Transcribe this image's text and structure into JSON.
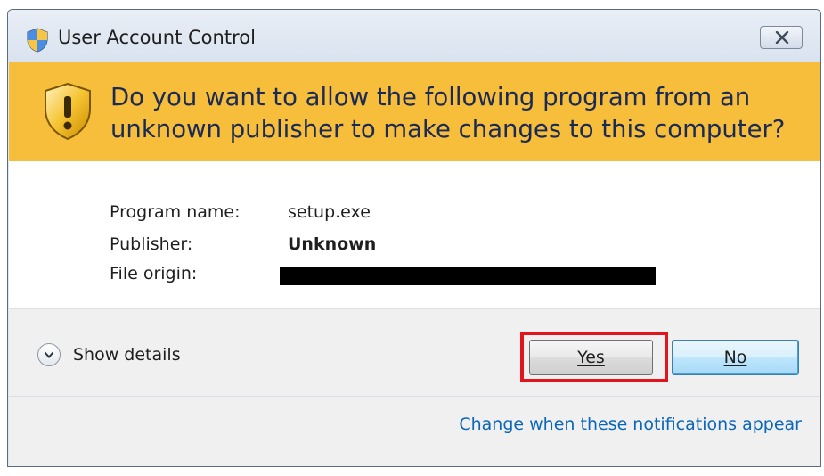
{
  "window": {
    "title": "User Account Control",
    "icon": "uac-shield-icon",
    "close_icon": "close-icon"
  },
  "banner": {
    "question": "Do you want to allow the following program from an unknown publisher to make changes to this computer?",
    "icon": "warning-shield-icon",
    "background_color": "#f6be3b"
  },
  "program_info": {
    "rows": [
      {
        "label": "Program name:",
        "value": "setup.exe"
      },
      {
        "label": "Publisher:",
        "value": "Unknown"
      },
      {
        "label": "File origin:",
        "value": ""
      }
    ]
  },
  "footer": {
    "show_details_label": "Show details",
    "yes_label": "Yes",
    "no_label": "No",
    "highlight_color": "#e0161c",
    "change_link": "Change when these notifications appear"
  }
}
